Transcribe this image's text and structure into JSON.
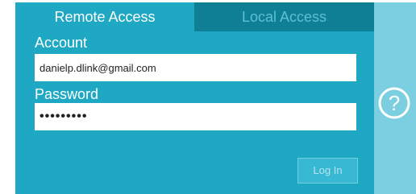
{
  "tabs": {
    "remote_label": "Remote Access",
    "local_label": "Local Access",
    "active": "Remote Access"
  },
  "form": {
    "account_label": "Account",
    "account_value": "danielp.dlink@gmail.com",
    "password_label": "Password",
    "password_value": "•••••••••",
    "login_label": "Log In"
  },
  "colors": {
    "panel": "#1ea8c4",
    "inactive_tab": "#0f7f95",
    "sidebar": "#7ccfe1"
  },
  "icons": {
    "help": "help-icon"
  }
}
